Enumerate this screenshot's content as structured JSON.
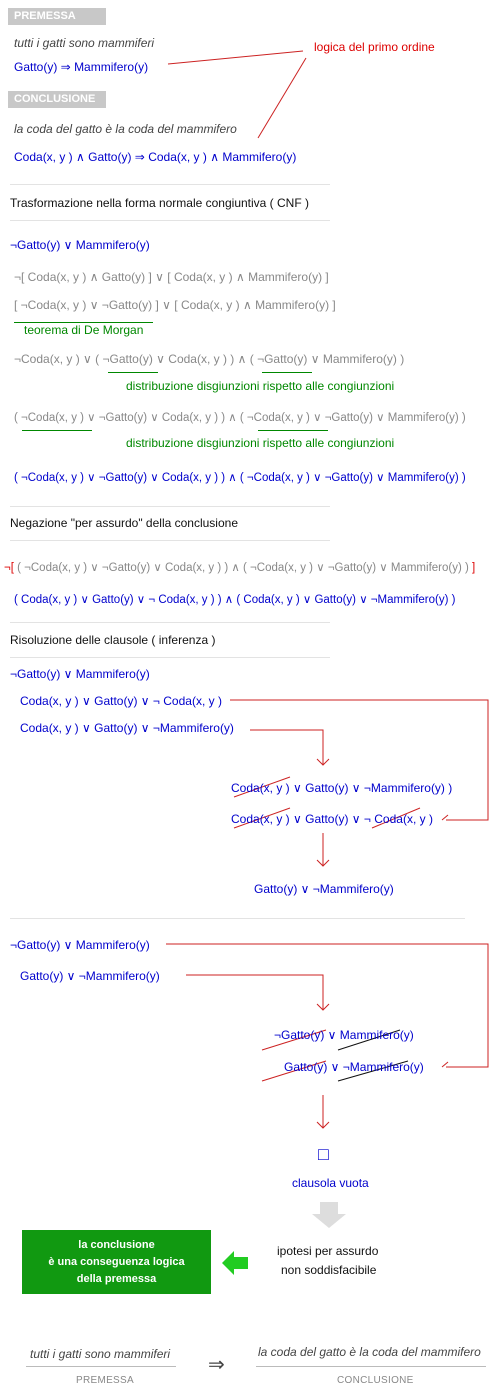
{
  "premessa": {
    "header": "PREMESSA",
    "italic": "tutti i gatti sono mammiferi",
    "formula": "Gatto(y) ⇒ Mammifero(y)"
  },
  "note_logic": "logica del primo ordine",
  "conclusione": {
    "header": "CONCLUSIONE",
    "italic": "la coda del gatto è la coda del mammifero",
    "formula": "Coda(x, y ) ∧ Gatto(y) ⇒ Coda(x, y ) ∧ Mammifero(y)"
  },
  "cnf": {
    "title": "Trasformazione nella forma normale congiuntiva ( CNF )",
    "l1": "¬Gatto(y) ∨ Mammifero(y)",
    "l2": "¬[ Coda(x, y ) ∧ Gatto(y) ] ∨ [ Coda(x, y ) ∧ Mammifero(y) ]",
    "l3": "[ ¬Coda(x, y ) ∨ ¬Gatto(y) ] ∨ [ Coda(x, y ) ∧ Mammifero(y) ]",
    "note_demorgan": "teorema di De Morgan",
    "l4": "¬Coda(x, y ) ∨ ( ¬Gatto(y) ∨ Coda(x, y ) ) ∧ ( ¬Gatto(y) ∨ Mammifero(y) )",
    "note_distr1": "distribuzione disgiunzioni rispetto alle congiunzioni",
    "l5": "( ¬Coda(x, y ) ∨ ¬Gatto(y) ∨ Coda(x, y ) ) ∧ ( ¬Coda(x, y ) ∨ ¬Gatto(y) ∨ Mammifero(y) )",
    "note_distr2": "distribuzione disgiunzioni rispetto alle congiunzioni",
    "l6": "( ¬Coda(x, y ) ∨ ¬Gatto(y) ∨ Coda(x, y ) ) ∧ ( ¬Coda(x, y ) ∨ ¬Gatto(y) ∨ Mammifero(y) )"
  },
  "negazione": {
    "title": "Negazione \"per assurdo\" della conclusione",
    "neg_open": "¬[",
    "neg_body": "( ¬Coda(x, y ) ∨ ¬Gatto(y) ∨ Coda(x, y ) ) ∧ ( ¬Coda(x, y ) ∨ ¬Gatto(y) ∨ Mammifero(y) )",
    "neg_close": "]",
    "result": "( Coda(x, y ) ∨ Gatto(y) ∨ ¬ Coda(x, y ) ) ∧ ( Coda(x, y ) ∨ Gatto(y) ∨ ¬Mammifero(y) )"
  },
  "risoluzione": {
    "title": "Risoluzione delle clausole ( inferenza )",
    "c1": "¬Gatto(y) ∨ Mammifero(y)",
    "c2": "Coda(x, y ) ∨ Gatto(y) ∨ ¬ Coda(x, y )",
    "c3": "Coda(x, y ) ∨ Gatto(y) ∨ ¬Mammifero(y)",
    "r1": "Coda(x, y ) ∨ Gatto(y) ∨ ¬Mammifero(y) )",
    "r2": "Coda(x, y ) ∨ Gatto(y) ∨ ¬ Coda(x, y )",
    "res1": "Gatto(y) ∨ ¬Mammifero(y)",
    "d1": "¬Gatto(y) ∨ Mammifero(y)",
    "d2": "Gatto(y) ∨ ¬Mammifero(y)",
    "s1": "¬Gatto(y) ∨ Mammifero(y)",
    "s2": "Gatto(y) ∨ ¬Mammifero(y)",
    "empty_symbol": "□",
    "empty_label": "clausola vuota"
  },
  "esito": {
    "box_l1": "la conclusione",
    "box_l2": "è una conseguenza logica",
    "box_l3": "della premessa",
    "side_l1": "ipotesi per assurdo",
    "side_l2": "non soddisfacibile"
  },
  "footer": {
    "left_italic": "tutti i gatti sono mammiferi",
    "left_label": "PREMESSA",
    "arrow": "⇒",
    "right_italic": "la coda del gatto è la coda del mammifero",
    "right_label": "CONCLUSIONE"
  },
  "colors": {
    "formula": "#0000cc",
    "muted": "#888888",
    "note": "#008800",
    "connector": "#cc0000",
    "box": "#119911",
    "header_bg": "#c8c8c8"
  }
}
